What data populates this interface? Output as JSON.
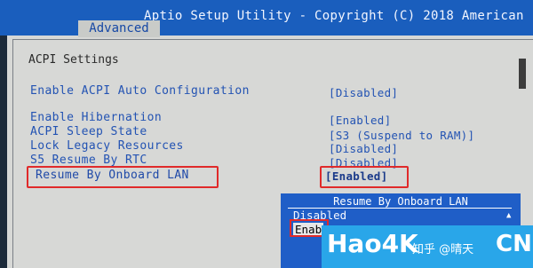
{
  "header": {
    "title": "Aptio Setup Utility - Copyright (C) 2018 American",
    "active_tab": "Advanced"
  },
  "page": {
    "section_title": "ACPI Settings"
  },
  "settings": [
    {
      "label": "Enable ACPI Auto Configuration",
      "value": "[Disabled]"
    },
    {
      "label": "Enable Hibernation",
      "value": "[Enabled]"
    },
    {
      "label": "ACPI Sleep State",
      "value": "[S3 (Suspend to RAM)]"
    },
    {
      "label": "Lock Legacy Resources",
      "value": "[Disabled]"
    },
    {
      "label": "S5 Resume By RTC",
      "value": "[Disabled]"
    },
    {
      "label": "Resume By Onboard LAN",
      "value": "[Enabled]"
    }
  ],
  "popup": {
    "title": "Resume By Onboard LAN",
    "options": [
      "Disabled",
      "Enab"
    ]
  },
  "watermark": {
    "main": "Hao4K",
    "sub": "知乎 @晴天",
    "cn": "CN"
  },
  "colors": {
    "title_bar": "#1a5ebd",
    "background": "#d7d8d6",
    "item_text": "#2353b3",
    "highlight_box": "#e02a2a",
    "popup_bg": "#1f5ec7",
    "watermark_bg": "#29a6e9"
  }
}
